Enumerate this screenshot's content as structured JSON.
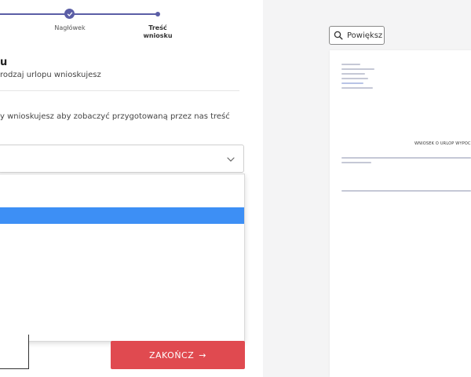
{
  "stepper": {
    "steps": [
      {
        "label": "Nagłówek",
        "state": "done"
      },
      {
        "label": "Treść wniosku",
        "state": "current"
      }
    ],
    "accent": "#5b5ea6"
  },
  "form": {
    "section_title": "u",
    "section_subtitle": "rodzaj urlopu wnioskujesz",
    "hint": "y wnioskujesz aby zobaczyć przygotowaną przez nas treść",
    "select_value": "",
    "options": [
      "",
      "",
      "",
      "",
      "",
      "",
      "",
      "",
      "",
      ""
    ],
    "selected_index": 2
  },
  "actions": {
    "finish_label": "ZAKOŃCZ",
    "finish_arrow": "→",
    "finish_color": "#e04a50"
  },
  "preview": {
    "zoom_label": "Powiększ",
    "doc_title": "WNIOSEK O URLOP WYPOC"
  },
  "icons": {
    "check": "check-icon",
    "chevron": "chevron-down-icon",
    "search": "search-icon"
  }
}
